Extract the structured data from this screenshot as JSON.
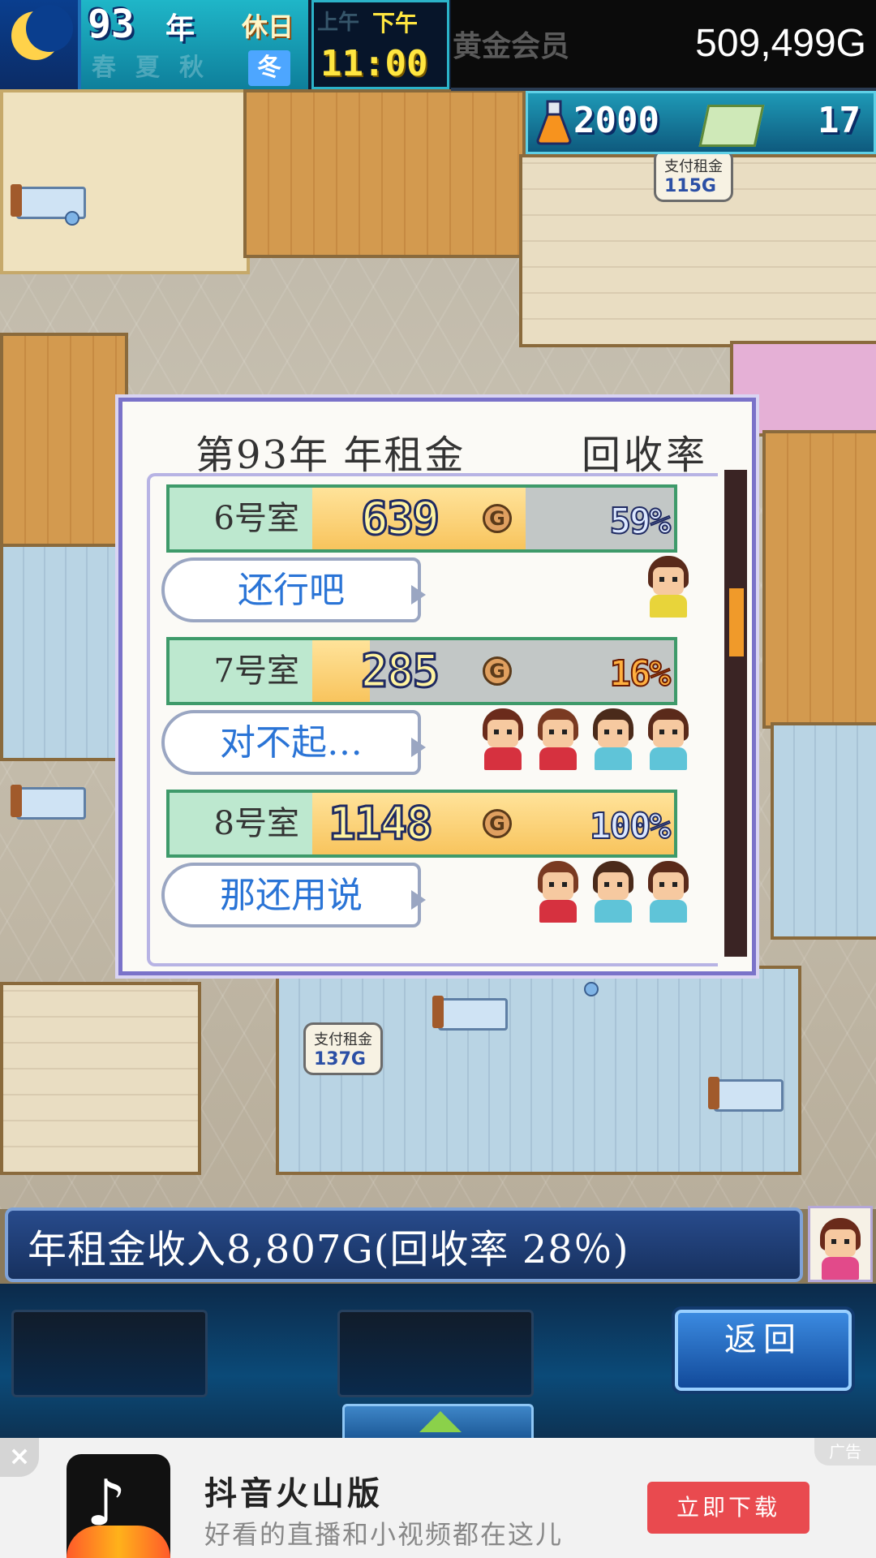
{
  "hud": {
    "year": "93",
    "year_unit": "年",
    "holiday": "休日",
    "seasons": [
      "春",
      "夏",
      "秋",
      "冬"
    ],
    "active_season": "冬",
    "am_label": "上午",
    "pm_label": "下午",
    "clock": "11:00",
    "member_label": "黄金会员",
    "money": "509,499G",
    "research_points": "2000",
    "tickets": "17"
  },
  "world": {
    "rent_bubble_top": {
      "label": "支付租金",
      "amount": "115G"
    },
    "rent_bubble_bottom": {
      "label": "支付租金",
      "amount": "137G"
    }
  },
  "dialog": {
    "title": "第93年 年租金",
    "rate_header": "回收率",
    "rows": [
      {
        "room": "6号室",
        "amount": "639",
        "percent": "59%",
        "ratio": 0.59,
        "comment": "还行吧",
        "residents": 1
      },
      {
        "room": "7号室",
        "amount": "285",
        "percent": "16%",
        "ratio": 0.16,
        "comment": "对不起…",
        "residents": 4
      },
      {
        "room": "8号室",
        "amount": "1148",
        "percent": "100%",
        "ratio": 1.0,
        "comment": "那还用说",
        "residents": 3
      }
    ],
    "gold_icon_letter": "G"
  },
  "footer": {
    "income_text": "年租金收入8,807G(回收率 28％)",
    "back_label": "返回"
  },
  "ad": {
    "close": "×",
    "tag": "广告",
    "app_name": "抖音火山版",
    "description": "好看的直播和小视频都在这儿",
    "button": "立即下载"
  },
  "colors": {
    "dialog_border": "#7a72c9",
    "bar_fill": "#f8c45d",
    "row_green": "#3e9a6a",
    "comment_text": "#2a74d6",
    "ad_button": "#e94a4f"
  }
}
